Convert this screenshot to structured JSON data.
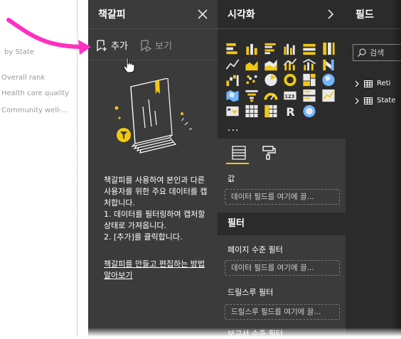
{
  "canvas": {
    "items": [
      "by State",
      "Overall rank",
      "Health care quality",
      "Community well-..."
    ]
  },
  "bookmarks_panel": {
    "title": "책갈피",
    "close_icon": "close-icon",
    "add_label": "추가",
    "view_label": "보기",
    "description": [
      "책갈피를 사용하여 본인과 다른 사용자를 위한 주요 데이터를 캡처합니다.",
      "1. 데이터를 필터링하여 캡처할 상태로 가져옵니다.",
      "2. [추가]를 클릭합니다."
    ],
    "learn_more": "책갈피를 만들고 편집하는 방법 알아보기"
  },
  "visualizations_panel": {
    "title": "시각화",
    "more_label": "...",
    "values_label": "값",
    "values_placeholder": "데이터 필드를 여기에 끌...",
    "filters_title": "필터",
    "page_filter_label": "페이지 수준 필터",
    "page_filter_placeholder": "데이터 필드를 여기에 끌...",
    "drillthrough_label": "드릴스루 필터",
    "drillthrough_placeholder": "드릴스루 필드를 여기에 끌...",
    "report_filter_label": "보고서 수준 필터",
    "icons": [
      [
        "stacked-bar-icon",
        "stacked-column-icon",
        "clustered-bar-icon",
        "clustered-column-icon",
        "100-bar-icon",
        "100-column-icon"
      ],
      [
        "line-chart-icon",
        "area-chart-icon",
        "stacked-area-icon",
        "line-column-icon",
        "line-clustered-icon",
        "ribbon-chart-icon"
      ],
      [
        "waterfall-icon",
        "scatter-icon",
        "pie-icon",
        "donut-icon",
        "treemap-icon",
        "map-icon"
      ],
      [
        "filled-map-icon",
        "funnel-icon",
        "gauge-icon",
        "card-icon",
        "multirow-card-icon",
        "kpi-icon"
      ],
      [
        "slicer-icon",
        "table-icon",
        "matrix-icon",
        "r-script-icon",
        "globe-icon"
      ]
    ]
  },
  "fields_panel": {
    "title": "필드",
    "search_placeholder": "검색",
    "tables": [
      "Reti",
      "State"
    ]
  },
  "colors": {
    "accent": "#f2c811",
    "annotation_arrow": "#ff2fbf",
    "panel_dark": "#2b2b2b",
    "panel_mid": "#3b3b3b"
  }
}
